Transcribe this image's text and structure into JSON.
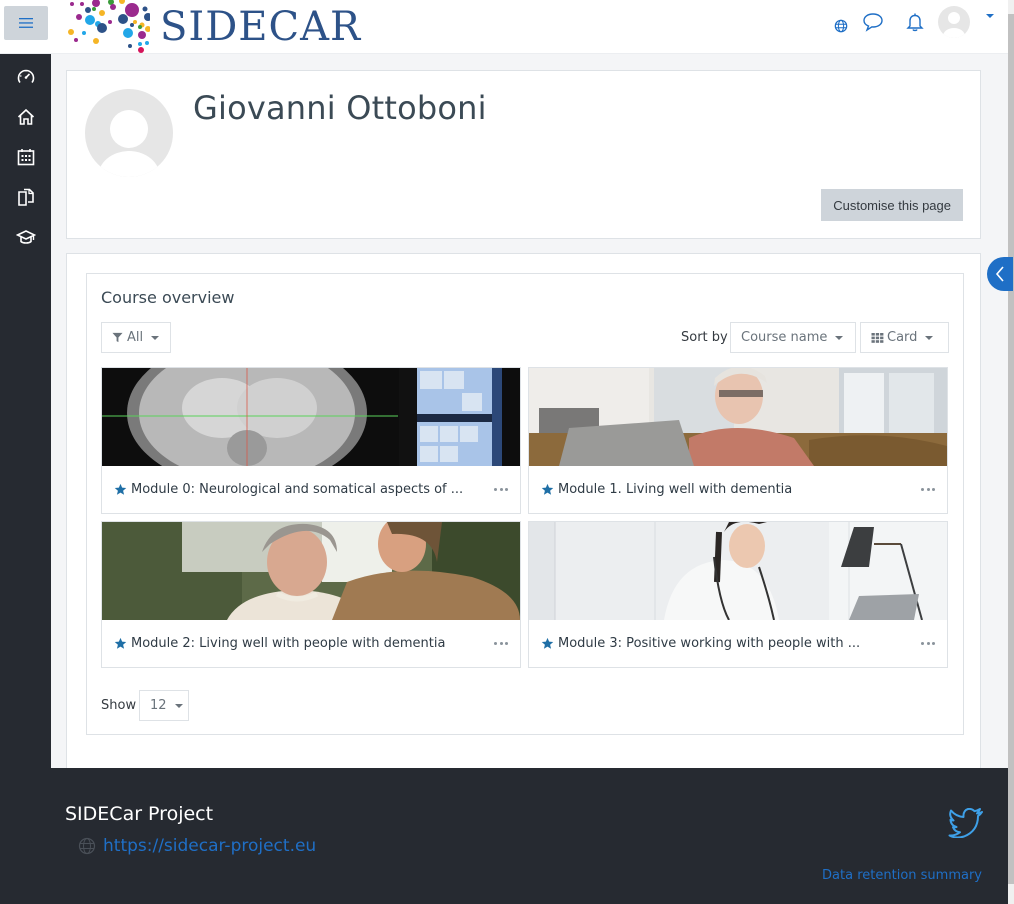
{
  "navbar": {
    "menu_icon": "hamburger-icon",
    "logo_text": "SIDECAR",
    "icons": [
      "globe-icon",
      "chat-bubble-icon",
      "bell-icon"
    ],
    "user_menu_icon": "user-avatar"
  },
  "sidebar": {
    "items": [
      {
        "icon": "dashboard-gauge-icon",
        "label": "Dashboard"
      },
      {
        "icon": "home-icon",
        "label": "Site home"
      },
      {
        "icon": "calendar-icon",
        "label": "Calendar"
      },
      {
        "icon": "files-icon",
        "label": "Private files"
      },
      {
        "icon": "graduation-cap-icon",
        "label": "My courses"
      }
    ]
  },
  "header": {
    "user_name": "Giovanni Ottoboni",
    "customise_label": "Customise this page"
  },
  "course_overview": {
    "title": "Course overview",
    "filter_label": "All",
    "sort_by_label": "Sort by",
    "sort_value": "Course name",
    "view_value": "Card",
    "show_label": "Show",
    "show_value": "12",
    "courses": [
      {
        "name": "Module 0: Neurological and somatical aspects of ...",
        "image": "mri-brain-scan",
        "starred": true
      },
      {
        "name": "Module 1. Living well with dementia",
        "image": "elderly-woman-laptop",
        "starred": true
      },
      {
        "name": "Module 2: Living well with people with dementia",
        "image": "elderly-woman-and-caregiver",
        "starred": true
      },
      {
        "name": "Module 3: Positive working with people with ...",
        "image": "doctor-at-desk",
        "starred": true
      }
    ]
  },
  "footer": {
    "title": "SIDECar Project",
    "link_text": "https://sidecar-project.eu",
    "data_retention": "Data retention summary",
    "social_icon": "twitter-icon"
  },
  "colors": {
    "accent": "#1f6fc6",
    "sidebar_bg": "#262a31",
    "logo_blue": "#2d5288"
  }
}
